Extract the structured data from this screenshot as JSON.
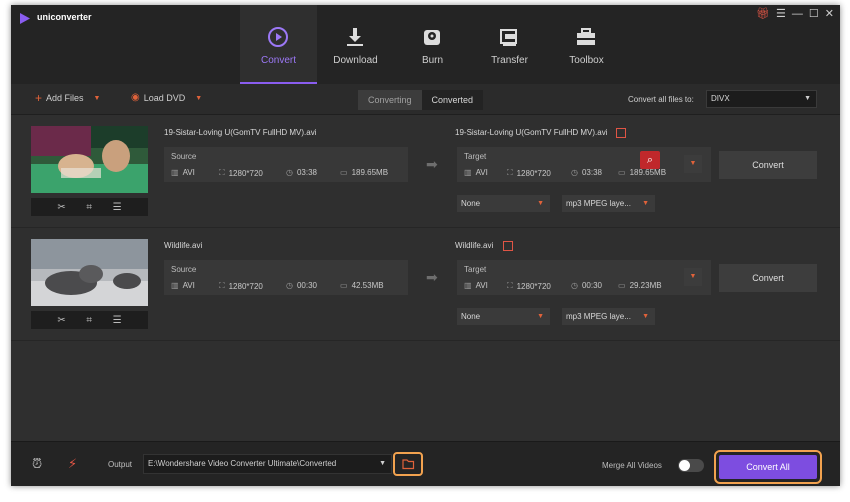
{
  "app": {
    "name": "uniconverter",
    "window_controls": [
      "gift-icon",
      "menu-icon",
      "minimize-icon",
      "maximize-icon",
      "close-icon"
    ]
  },
  "nav": {
    "tabs": [
      {
        "label": "Convert",
        "icon": "convert-icon",
        "active": true
      },
      {
        "label": "Download",
        "icon": "download-icon",
        "active": false
      },
      {
        "label": "Burn",
        "icon": "burn-icon",
        "active": false
      },
      {
        "label": "Transfer",
        "icon": "transfer-icon",
        "active": false
      },
      {
        "label": "Toolbox",
        "icon": "toolbox-icon",
        "active": false
      }
    ]
  },
  "toolbar": {
    "add_files": "Add Files",
    "load_dvd": "Load DVD",
    "seg_converting": "Converting",
    "seg_converted": "Converted",
    "convert_all_to_label": "Convert all files to:",
    "convert_all_to_value": "DIVX"
  },
  "files": [
    {
      "source_name": "19-Sistar-Loving U(GomTV FullHD MV).avi",
      "target_name": "19-Sistar-Loving U(GomTV FullHD MV).avi",
      "source": {
        "title": "Source",
        "format": "AVI",
        "resolution": "1280*720",
        "duration": "03:38",
        "size": "189.65MB"
      },
      "target": {
        "title": "Target",
        "format": "AVI",
        "resolution": "1280*720",
        "duration": "03:38",
        "size": "189.65MB"
      },
      "subtitle": "None",
      "audio": "mp3 MPEG laye...",
      "convert_label": "Convert"
    },
    {
      "source_name": "Wildlife.avi",
      "target_name": "Wildlife.avi",
      "source": {
        "title": "Source",
        "format": "AVI",
        "resolution": "1280*720",
        "duration": "00:30",
        "size": "42.53MB"
      },
      "target": {
        "title": "Target",
        "format": "AVI",
        "resolution": "1280*720",
        "duration": "00:30",
        "size": "29.23MB"
      },
      "subtitle": "None",
      "audio": "mp3 MPEG laye...",
      "convert_label": "Convert"
    }
  ],
  "footer": {
    "output_label": "Output",
    "output_path": "E:\\Wondershare Video Converter Ultimate\\Converted",
    "merge_label": "Merge All Videos",
    "merge_enabled": false,
    "convert_all": "Convert All"
  },
  "colors": {
    "accent_purple": "#7d4de0",
    "highlight_orange": "#f2a24f",
    "accent_red": "#e05545"
  }
}
